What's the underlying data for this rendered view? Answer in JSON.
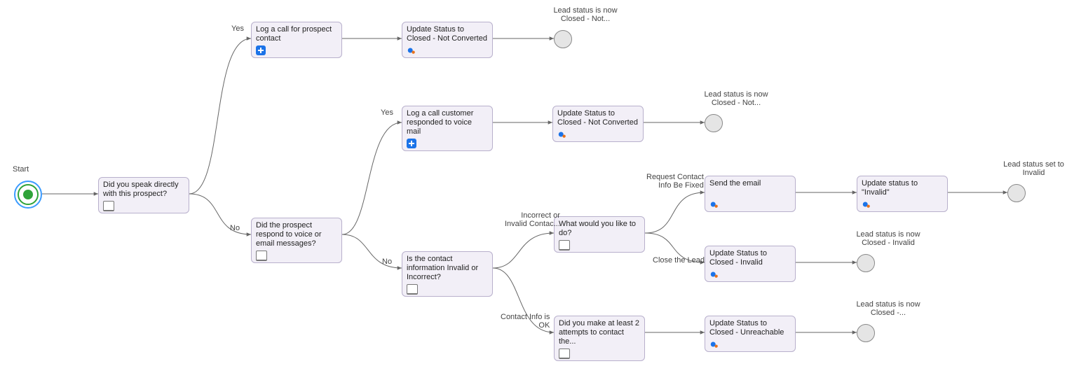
{
  "start_label": "Start",
  "nodes": {
    "speak": {
      "title": "Did you speak directly with this prospect?",
      "icon": "screen"
    },
    "logcall1": {
      "title": "Log a call for prospect contact",
      "icon": "plus"
    },
    "update1": {
      "title": "Update Status to Closed - Not Converted",
      "icon": "gear"
    },
    "respond": {
      "title": "Did the prospect respond to voice or email messages?",
      "icon": "screen"
    },
    "logcall2": {
      "title": "Log a call customer responded to voice mail",
      "icon": "plus"
    },
    "update2": {
      "title": "Update Status to Closed - Not Converted",
      "icon": "gear"
    },
    "invalid": {
      "title": "Is the contact information Invalid or Incorrect?",
      "icon": "screen"
    },
    "what": {
      "title": "What would you like to do?",
      "icon": "screen"
    },
    "sendemail": {
      "title": "Send the email",
      "icon": "gear"
    },
    "updateinv": {
      "title": "Update status to \"Invalid\"",
      "icon": "gear"
    },
    "updateci": {
      "title": "Update Status to Closed - Invalid",
      "icon": "gear"
    },
    "attempts": {
      "title": "Did you make at least 2 attempts to contact the...",
      "icon": "screen"
    },
    "updateun": {
      "title": "Update Status to Closed - Unreachable",
      "icon": "gear"
    }
  },
  "end_labels": {
    "e1": "Lead status is now\nClosed - Not...",
    "e2": "Lead status is now\nClosed - Not...",
    "e3": "Lead status set to\nInvalid",
    "e4": "Lead status is now\nClosed - Invalid",
    "e5": "Lead status is now\nClosed -..."
  },
  "edge_labels": {
    "yes1": "Yes",
    "no1": "No",
    "yes2": "Yes",
    "no2": "No",
    "incorrect": "Incorrect or\nInvalid Contac...",
    "contactok": "Contact Info is\nOK",
    "reqfix": "Request Contact\nInfo Be Fixed",
    "closelead": "Close the Lead"
  }
}
